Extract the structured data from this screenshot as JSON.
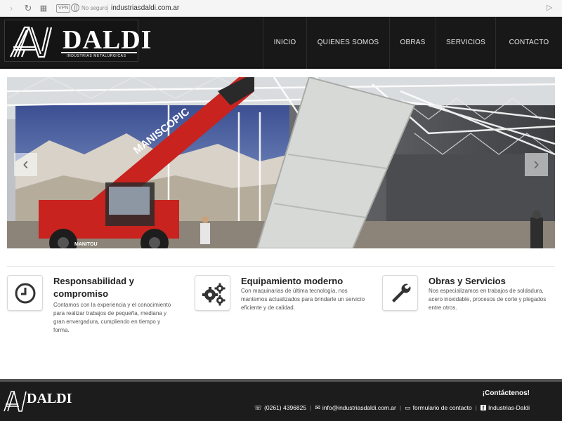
{
  "browser": {
    "vpn_label": "VPN",
    "security_text": "No seguro",
    "url": "industriasdaldi.com.ar"
  },
  "header": {
    "logo_name": "DALDI",
    "logo_subtitle": "INDUSTRIAS METALURGICAS",
    "nav": [
      {
        "label": "INICIO"
      },
      {
        "label": "QUIENES SOMOS"
      },
      {
        "label": "OBRAS"
      },
      {
        "label": "SERVICIOS"
      },
      {
        "label": "CONTACTO"
      }
    ]
  },
  "hero": {
    "prev_arrow": "‹",
    "next_arrow": "›",
    "boom_text": "MANISCOPIC",
    "body_text": "MANITOU"
  },
  "features": [
    {
      "icon": "clock-icon",
      "title_line1": "Responsabilidad y",
      "title_line2": "compromiso",
      "text": "Contamos con la experiencia y el conocimiento para realizar trabajos de pequeña, mediana y gran envergadura, cumpliendo en tiempo y forma."
    },
    {
      "icon": "cogs-icon",
      "title": "Equipamiento moderno",
      "text": "Con maquinarias de última tecnología, nos mantemos actualizados para brindarle un servicio eficiente y de calidad."
    },
    {
      "icon": "wrench-icon",
      "title": "Obras y Servicios",
      "text": "Nos especializamos en trabajos de soldadura, acero inoxidable, procesos de corte y plegados entre otros."
    }
  ],
  "footer": {
    "logo_name": "DALDI",
    "cta": "¡Contáctenos!",
    "phone": "(0261) 4396825",
    "email": "info@industriasdaldi.com.ar",
    "form_link": "formulario de contacto",
    "facebook": "Industrias-Daldi"
  },
  "colors": {
    "header_bg": "#181818",
    "footer_bg": "#1c1c1c",
    "crane_red": "#c8231e"
  }
}
